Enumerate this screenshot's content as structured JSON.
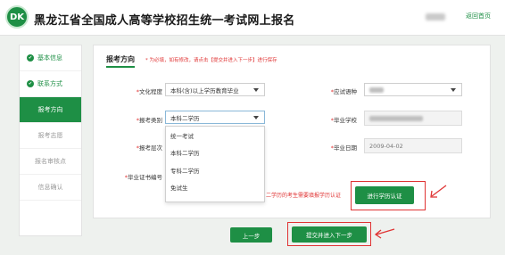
{
  "header": {
    "logo_text": "DK",
    "title": "黑龙江省全国成人高等学校招生统一考试网上报名",
    "home_link": "返回首页"
  },
  "sidebar": {
    "items": [
      {
        "label": "基本信息"
      },
      {
        "label": "联系方式"
      },
      {
        "label": "报考方向"
      },
      {
        "label": "报考志愿"
      },
      {
        "label": "报名审核点"
      },
      {
        "label": "信息确认"
      }
    ]
  },
  "form": {
    "tab_title": "报考方向",
    "note": "* 为必填，如有修改，请点击【提交并进入下一步】进行保存",
    "education": {
      "label": "文化程度",
      "value": "本科(含)以上学历教育毕业"
    },
    "category": {
      "label": "报考类别",
      "value": "本科二学历"
    },
    "level": {
      "label": "报考层次"
    },
    "cert_no": {
      "label": "毕业证书编号"
    },
    "language": {
      "label": "应试语种"
    },
    "school": {
      "label": "毕业学校"
    },
    "grad_date": {
      "label": "毕业日期",
      "value": "2009-04-02"
    },
    "dropdown_options": [
      "统一考试",
      "本科二学历",
      "专科二学历",
      "免试生"
    ],
    "cert_note": "二学历的考生需要填报学历认证",
    "verify_button": "进行学历认证"
  },
  "actions": {
    "prev": "上一步",
    "submit": "提交并进入下一步"
  },
  "colors": {
    "brand_green": "#1e8f45",
    "highlight_red": "#e03333"
  }
}
